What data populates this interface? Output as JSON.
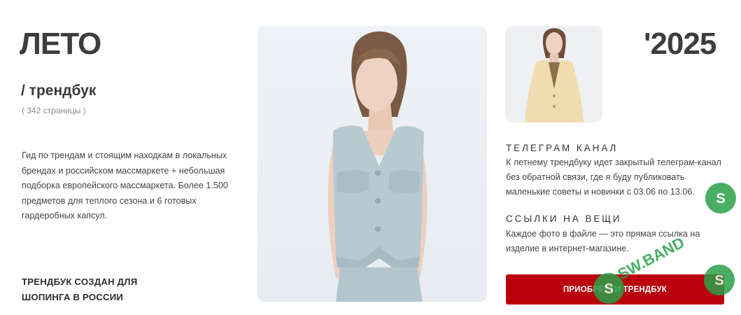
{
  "header": {
    "title_left": "ЛЕТО",
    "title_right": "'2025"
  },
  "intro": {
    "subtitle": "/ трендбук",
    "pages": "( 342 страницы )",
    "description": "Гид по трендам и стоящим находкам в локальных брендах и российском массмаркете + небольшая подборка европейского массмаркета. Более 1.500 предметов для теплого сезона и 6 готовых гардеробных капсул.",
    "made_for": "ТРЕНДБУК СОЗДАН ДЛЯ ШОПИНГА В РОССИИ"
  },
  "telegram": {
    "title": "ТЕЛЕГРАМ КАНАЛ",
    "text": "К летнему трендбуку идет закрытый телеграм-канал без обратной связи, где я буду публиковать маленькие советы и новинки с 03.06 по 13.06."
  },
  "links": {
    "title": "ССЫЛКИ НА ВЕЩИ",
    "text": "Каждое фото в файле — это прямая ссылка на изделие в интернет-магазине."
  },
  "cta": {
    "buy_label": "ПРИОБРЕСТИ ТРЕНДБУК"
  },
  "watermark": {
    "text": "SW.BAND",
    "color": "#2aa14a"
  },
  "colors": {
    "accent": "#b9000c",
    "vest": "#b7c9d1",
    "blazer": "#f0dcae"
  }
}
